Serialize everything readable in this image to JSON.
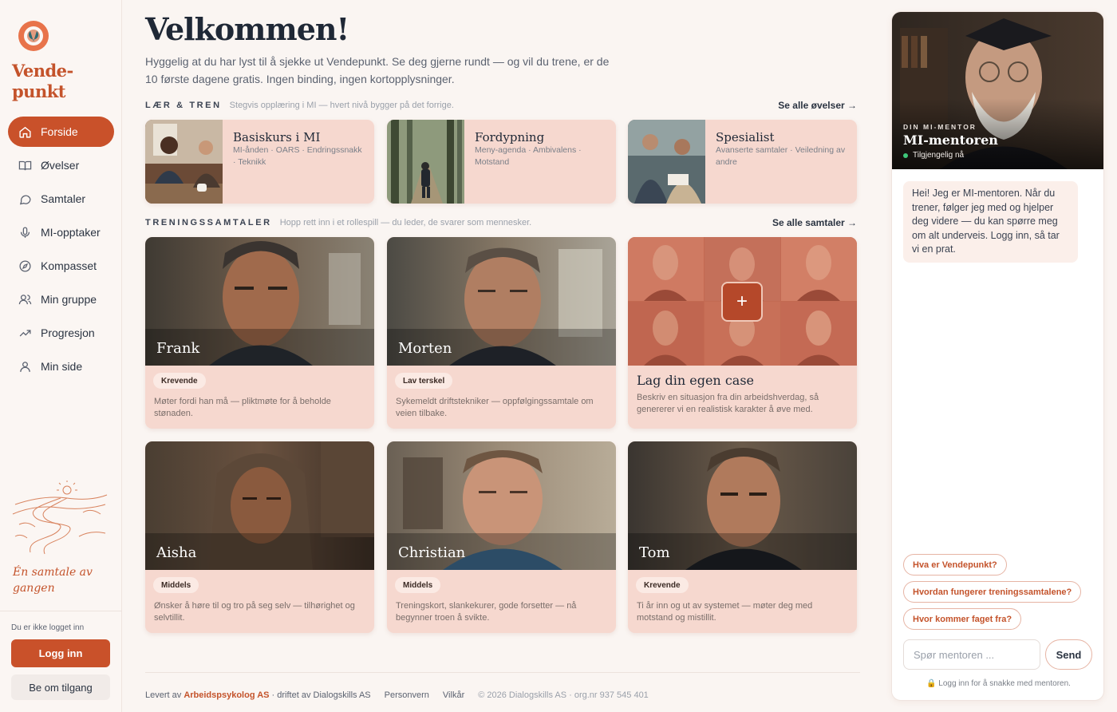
{
  "brand": {
    "name_line1": "Vende-",
    "name_line2": "punkt",
    "tagline": "Én samtale av gangen"
  },
  "sidebar": {
    "items": [
      {
        "label": "Forside",
        "icon": "home-icon",
        "active": true
      },
      {
        "label": "Øvelser",
        "icon": "book-icon",
        "active": false
      },
      {
        "label": "Samtaler",
        "icon": "chat-bubble-icon",
        "active": false
      },
      {
        "label": "MI-opptaker",
        "icon": "microphone-icon",
        "active": false
      },
      {
        "label": "Kompasset",
        "icon": "compass-icon",
        "active": false
      },
      {
        "label": "Min gruppe",
        "icon": "users-icon",
        "active": false
      },
      {
        "label": "Progresjon",
        "icon": "trending-up-icon",
        "active": false
      },
      {
        "label": "Min side",
        "icon": "user-icon",
        "active": false
      }
    ],
    "logged_out_text": "Du er ikke logget inn",
    "login_label": "Logg inn",
    "access_label": "Be om tilgang"
  },
  "main": {
    "title": "Velkommen!",
    "intro": "Hyggelig at du har lyst til å sjekke ut Vendepunkt. Se deg gjerne rundt — og vil du trene, er de 10 første dagene gratis. Ingen binding, ingen kortopplysninger.",
    "learn": {
      "kicker": "LÆR & TREN",
      "sub": "Stegvis opplæring i MI — hvert nivå bygger på det forrige.",
      "link": "Se alle øvelser →",
      "courses": [
        {
          "title": "Basiskurs i MI",
          "desc": "MI-ånden · OARS · Endringssnakk · Teknikk"
        },
        {
          "title": "Fordypning",
          "desc": "Meny-agenda · Ambivalens · Motstand"
        },
        {
          "title": "Spesialist",
          "desc": "Avanserte samtaler · Veiledning av andre"
        }
      ]
    },
    "practice": {
      "kicker": "TRENINGSSAMTALER",
      "sub": "Hopp rett inn i et rollespill — du leder, de svarer som mennesker.",
      "link": "Se alle samtaler →",
      "personas": [
        {
          "name": "Frank",
          "badge": "Krevende",
          "desc": "Møter fordi han må — pliktmøte for å beholde stønaden."
        },
        {
          "name": "Morten",
          "badge": "Lav terskel",
          "desc": "Sykemeldt driftstekniker — oppfølgingssamtale om veien tilbake."
        },
        {
          "name": "Aisha",
          "badge": "Middels",
          "desc": "Ønsker å høre til og tro på seg selv — tilhørighet og selvtillit."
        },
        {
          "name": "Christian",
          "badge": "Middels",
          "desc": "Treningskort, slankekurer, gode forsetter — nå begynner troen å svikte."
        },
        {
          "name": "Tom",
          "badge": "Krevende",
          "desc": "Ti år inn og ut av systemet — møter deg med motstand og mistillit."
        }
      ],
      "own_case": {
        "title": "Lag din egen case",
        "desc": "Beskriv en situasjon fra din arbeidshverdag, så genererer vi en realistisk karakter å øve med.",
        "plus": "+"
      }
    }
  },
  "footer": {
    "delivered_prefix": "Levert av",
    "delivered_brand": "Arbeidspsykolog AS",
    "delivered_suffix": "· driftet av Dialogskills AS",
    "privacy": "Personvern",
    "terms": "Vilkår",
    "copyright": "© 2026 Dialogskills AS · org.nr 937 545 401"
  },
  "mentor": {
    "kicker": "DIN MI-MENTOR",
    "name": "MI-mentoren",
    "status": "Tilgjengelig nå",
    "greeting": "Hei! Jeg er MI-mentoren. Når du trener, følger jeg med og hjelper deg videre — du kan spørre meg om alt underveis. Logg inn, så tar vi en prat.",
    "suggestions": [
      "Hva er Vendepunkt?",
      "Hvordan fungerer treningssamtalene?",
      "Hvor kommer faget fra?"
    ],
    "input_placeholder": "Spør mentoren ...",
    "send_label": "Send",
    "login_hint": "🔒 Logg inn for å snakke med mentoren."
  },
  "colors": {
    "accent": "#c9512a",
    "card": "#f6d8cf",
    "background": "#faf5f2"
  }
}
